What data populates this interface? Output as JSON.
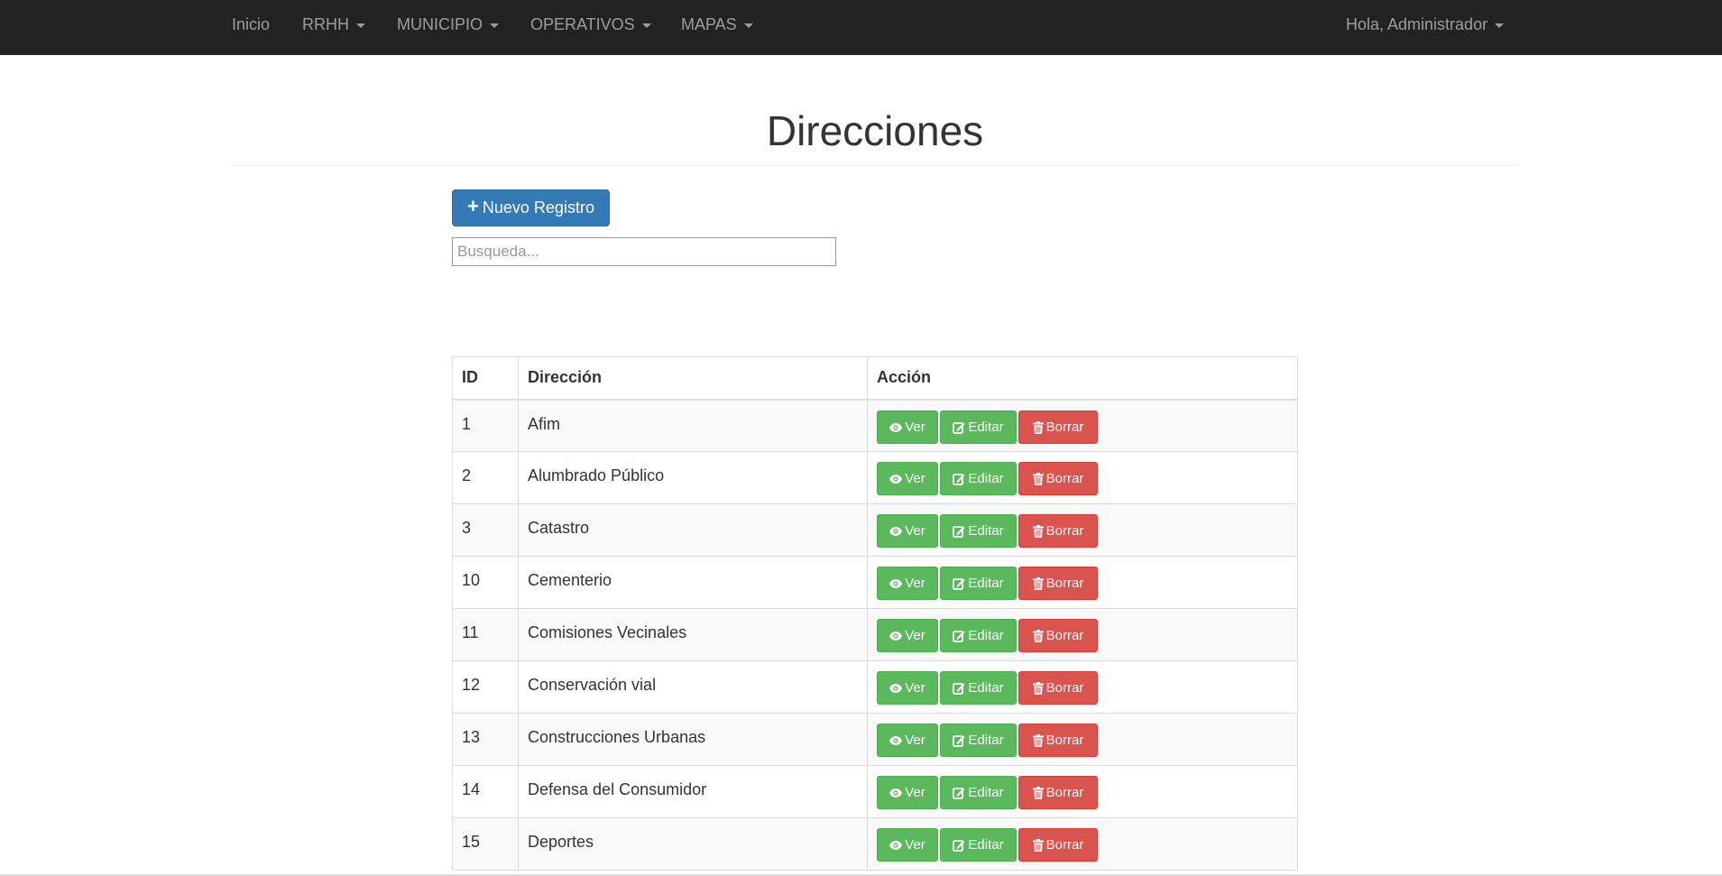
{
  "nav": {
    "items": [
      {
        "label": "Inicio",
        "dropdown": false
      },
      {
        "label": "RRHH",
        "dropdown": true
      },
      {
        "label": "MUNICIPIO",
        "dropdown": true
      },
      {
        "label": "OPERATIVOS",
        "dropdown": true
      },
      {
        "label": "MAPAS",
        "dropdown": true
      }
    ],
    "user_label": "Hola, Administrador"
  },
  "page": {
    "title": "Direcciones",
    "new_button": "Nuevo Registro",
    "search_placeholder": "Busqueda...",
    "search_value": ""
  },
  "table": {
    "headers": [
      "ID",
      "Dirección",
      "Acción"
    ],
    "rows": [
      {
        "id": "1",
        "name": "Afim"
      },
      {
        "id": "2",
        "name": "Alumbrado Público"
      },
      {
        "id": "3",
        "name": "Catastro"
      },
      {
        "id": "10",
        "name": "Cementerio"
      },
      {
        "id": "11",
        "name": "Comisiones Vecinales"
      },
      {
        "id": "12",
        "name": "Conservación vial"
      },
      {
        "id": "13",
        "name": "Construcciones Urbanas"
      },
      {
        "id": "14",
        "name": "Defensa del Consumidor"
      },
      {
        "id": "15",
        "name": "Deportes"
      }
    ],
    "actions": {
      "view": "Ver",
      "edit": "Editar",
      "delete": "Borrar"
    }
  },
  "colors": {
    "navbar": "#222222",
    "primary": "#337ab7",
    "success": "#5cb85c",
    "danger": "#d9534f"
  },
  "icons": {
    "new": "plus-icon",
    "view": "eye-icon",
    "edit": "edit-icon",
    "delete": "trash-icon",
    "dropdown": "caret-down-icon"
  }
}
